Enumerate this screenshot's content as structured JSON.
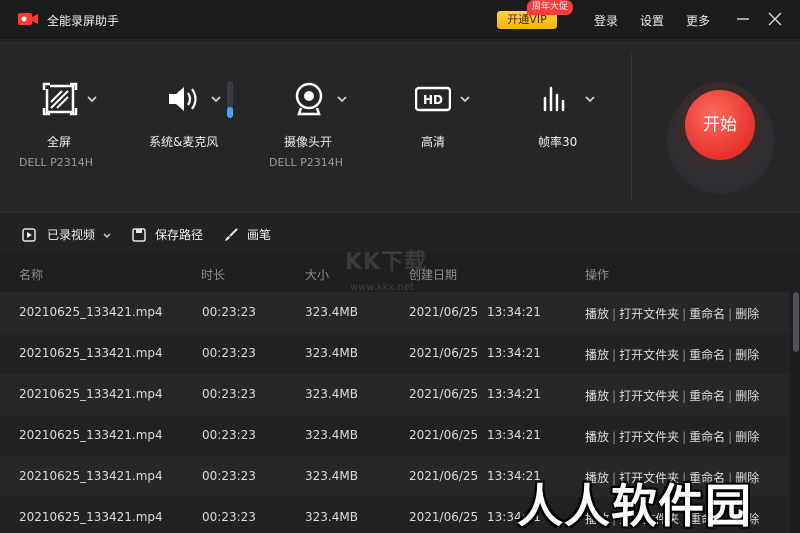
{
  "titlebar": {
    "app_title": "全能录屏助手",
    "vip_button": "开通VIP",
    "vip_badge": "周年大促",
    "login": "登录",
    "settings": "设置",
    "more": "更多"
  },
  "controls": {
    "fullscreen": {
      "label": "全屏",
      "sub": "DELL P2314H",
      "icon": "fullscreen-icon"
    },
    "audio": {
      "label": "系统&麦克风",
      "icon": "speaker-icon",
      "volume": 0.3
    },
    "camera": {
      "label": "摄像头开",
      "sub": "DELL P2314H",
      "icon": "webcam-icon"
    },
    "quality": {
      "label": "高清",
      "icon": "hd-icon",
      "badge": "HD"
    },
    "framerate": {
      "label": "帧率30",
      "icon": "bars-icon"
    },
    "start_button": "开始"
  },
  "toolbar": {
    "recorded": "已录视频",
    "save_path": "保存路径",
    "brush": "画笔"
  },
  "table": {
    "headers": [
      "名称",
      "时长",
      "大小",
      "创建日期",
      "操作"
    ],
    "rows": [
      {
        "name": "20210625_133421.mp4",
        "duration": "00:23:23",
        "size": "323.4MB",
        "date": "2021/06/25",
        "time": "13:34:21"
      },
      {
        "name": "20210625_133421.mp4",
        "duration": "00:23:23",
        "size": "323.4MB",
        "date": "2021/06/25",
        "time": "13:34:21"
      },
      {
        "name": "20210625_133421.mp4",
        "duration": "00:23:23",
        "size": "323.4MB",
        "date": "2021/06/25",
        "time": "13:34:21"
      },
      {
        "name": "20210625_133421.mp4",
        "duration": "00:23:23",
        "size": "323.4MB",
        "date": "2021/06/25",
        "time": "13:34:21"
      },
      {
        "name": "20210625_133421.mp4",
        "duration": "00:23:23",
        "size": "323.4MB",
        "date": "2021/06/25",
        "time": "13:34:21"
      },
      {
        "name": "20210625_133421.mp4",
        "duration": "00:23:23",
        "size": "323.4MB",
        "date": "2021/06/25",
        "time": "13:34:21"
      }
    ],
    "actions": [
      "播放",
      "打开文件夹",
      "重命名",
      "删除"
    ],
    "action_separator": "|"
  },
  "watermarks": {
    "kkx": "KK下载",
    "kkx_url": "www.kkx.net",
    "site": "人人软件园"
  },
  "colors": {
    "accent_start": "#e6322b",
    "vip": "#f6b500",
    "volume": "#4aa0ff",
    "logo": "#ff3b30"
  }
}
